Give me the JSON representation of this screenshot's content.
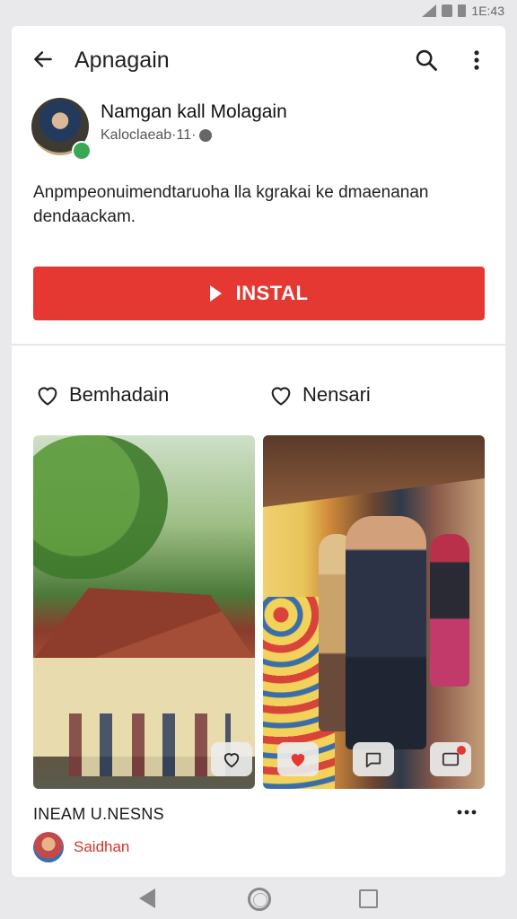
{
  "status": {
    "time": "1E:43"
  },
  "header": {
    "title": "Apnagain"
  },
  "profile": {
    "name": "Namgan kall Molagain",
    "meta": "Kaloclaeab·11·"
  },
  "description": "Anpmpeonuimendtaruoha lla kgrakai ke dmaenanan dendaackam.",
  "install": {
    "label": "INSTAL"
  },
  "tabs": [
    {
      "label": "Bemhadain"
    },
    {
      "label": "Nensari"
    }
  ],
  "section": {
    "title": "INEAM U.NESNS"
  },
  "author": {
    "name": "Saidhan"
  },
  "colors": {
    "accent": "#e53832",
    "link": "#d8322c",
    "card_bg": "#ffffff",
    "page_bg": "#e9e9ec"
  }
}
